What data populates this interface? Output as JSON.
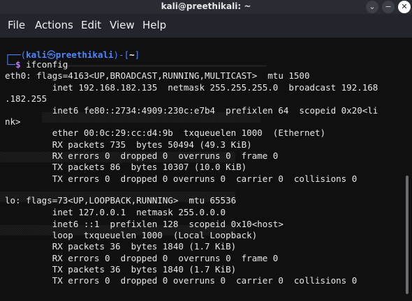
{
  "window": {
    "title": "kali@preethikali: ~",
    "buttons": [
      "⌄",
      "−",
      "✕"
    ]
  },
  "menu": [
    "File",
    "Actions",
    "Edit",
    "View",
    "Help"
  ],
  "prompt": {
    "corner_top": "┌──(",
    "user": "kali",
    "at": "㉿",
    "host": "preethikali",
    "mid": ")-[",
    "dir": "~",
    "end": "]",
    "corner_bottom": "└─",
    "symbol": "$",
    "command": "ifconfig"
  },
  "output": [
    "eth0: flags=4163<UP,BROADCAST,RUNNING,MULTICAST>  mtu 1500",
    "         inet 192.168.182.135  netmask 255.255.255.0  broadcast 192.168",
    ".182.255",
    "         inet6 fe80::2734:4909:230c:e7b4  prefixlen 64  scopeid 0x20<li",
    "nk>",
    "         ether 00:0c:29:cc:d4:9b  txqueuelen 1000  (Ethernet)",
    "         RX packets 735  bytes 50494 (49.3 KiB)",
    "         RX errors 0  dropped 0  overruns 0  frame 0",
    "         TX packets 86  bytes 10307 (10.0 KiB)",
    "         TX errors 0  dropped 0 overruns 0  carrier 0  collisions 0",
    "",
    "lo: flags=73<UP,LOOPBACK,RUNNING>  mtu 65536",
    "         inet 127.0.0.1  netmask 255.0.0.0",
    "         inet6 ::1  prefixlen 128  scopeid 0x10<host>",
    "         loop  txqueuelen 1000  (Local Loopback)",
    "         RX packets 36  bytes 1840 (1.7 KiB)",
    "         RX errors 0  dropped 0  overruns 0  frame 0",
    "         TX packets 36  bytes 1840 (1.7 KiB)",
    "         TX errors 0  dropped 0 overruns 0  carrier 0  collisions 0"
  ],
  "colors": {
    "prompt_blue": "#4d86ff",
    "host_purple": "#c77dff",
    "background": "#101010"
  }
}
